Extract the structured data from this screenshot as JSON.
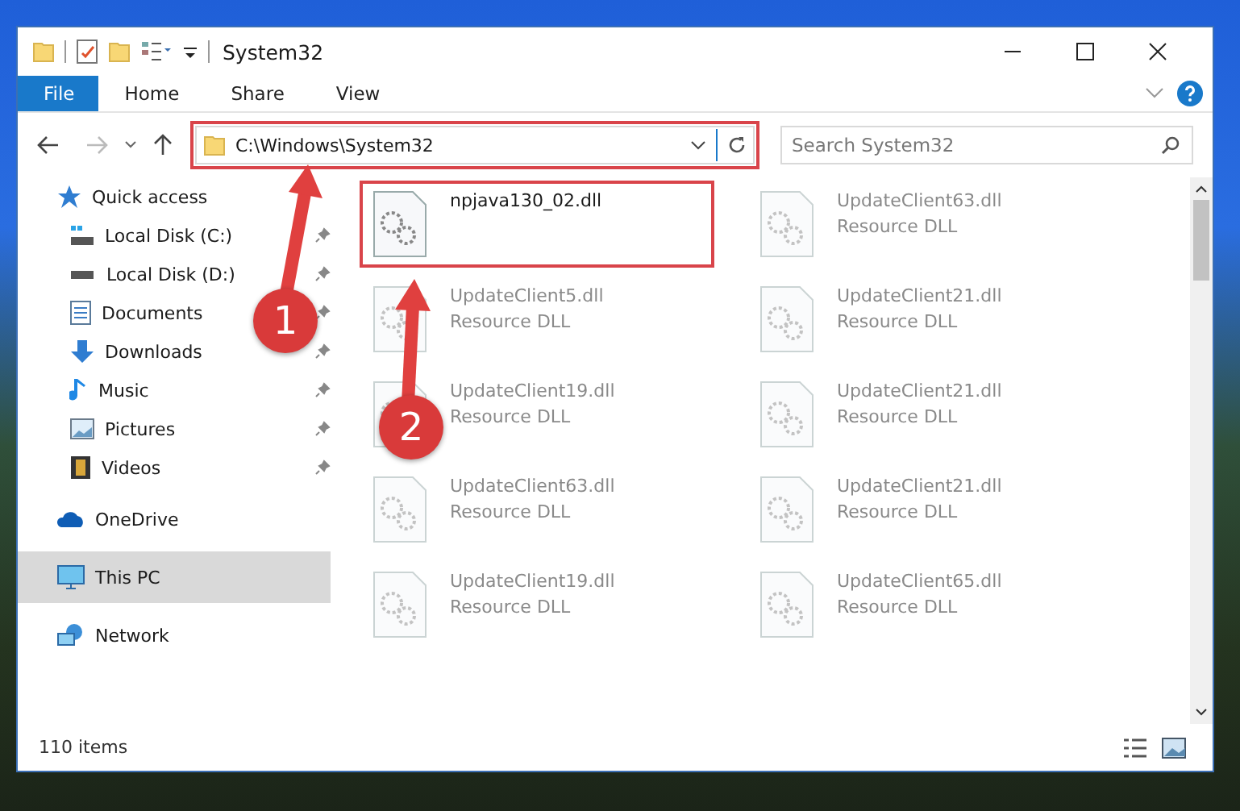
{
  "window": {
    "title": "System32"
  },
  "ribbon_tabs": [
    {
      "label": "File",
      "kind": "file",
      "selected": false
    },
    {
      "label": "Home",
      "kind": "tab",
      "selected": false
    },
    {
      "label": "Share",
      "kind": "tab",
      "selected": false
    },
    {
      "label": "View",
      "kind": "tab",
      "selected": false
    }
  ],
  "address_bar": {
    "path": "C:\\Windows\\System32",
    "highlighted": true
  },
  "search": {
    "placeholder": "Search System32"
  },
  "sidebar": {
    "items": [
      {
        "label": "Quick access",
        "kind": "star",
        "selected": false,
        "children": [
          {
            "label": "Local Disk (C:)",
            "kind": "drive-c",
            "pinned": true,
            "selected": false
          },
          {
            "label": "Local Disk (D:)",
            "kind": "drive",
            "pinned": true,
            "selected": false
          },
          {
            "label": "Documents",
            "kind": "document",
            "pinned": true,
            "selected": false
          },
          {
            "label": "Downloads",
            "kind": "download",
            "pinned": true,
            "selected": false
          },
          {
            "label": "Music",
            "kind": "music",
            "pinned": true,
            "selected": false
          },
          {
            "label": "Pictures",
            "kind": "picture",
            "pinned": true,
            "selected": false
          },
          {
            "label": "Videos",
            "kind": "video",
            "pinned": true,
            "selected": false
          }
        ]
      },
      {
        "label": "OneDrive",
        "kind": "cloud",
        "selected": false
      },
      {
        "label": "This PC",
        "kind": "computer",
        "selected": true
      },
      {
        "label": "Network",
        "kind": "network",
        "selected": false
      }
    ]
  },
  "files": [
    {
      "name": "npjava130_02.dll",
      "highlighted": true,
      "blurred": false
    },
    {
      "name": "UpdateClient63.dll",
      "type": "Resource DLL",
      "highlighted": false,
      "blurred": true
    },
    {
      "name": "UpdateClient5.dll",
      "type": "Resource DLL",
      "highlighted": false,
      "blurred": true
    },
    {
      "name": "UpdateClient21.dll",
      "type": "Resource DLL",
      "highlighted": false,
      "blurred": true
    },
    {
      "name": "UpdateClient19.dll",
      "type": "Resource DLL",
      "highlighted": false,
      "blurred": true
    },
    {
      "name": "UpdateClient21.dll",
      "type": "Resource DLL",
      "highlighted": false,
      "blurred": true
    },
    {
      "name": "UpdateClient63.dll",
      "type": "Resource DLL",
      "highlighted": false,
      "blurred": true
    },
    {
      "name": "UpdateClient21.dll",
      "type": "Resource DLL",
      "highlighted": false,
      "blurred": true
    },
    {
      "name": "UpdateClient19.dll",
      "type": "Resource DLL",
      "highlighted": false,
      "blurred": true
    },
    {
      "name": "UpdateClient65.dll",
      "type": "Resource DLL",
      "highlighted": false,
      "blurred": true
    }
  ],
  "status_bar": {
    "item_count": "110 items"
  },
  "callouts": [
    {
      "number": "1"
    },
    {
      "number": "2"
    }
  ]
}
